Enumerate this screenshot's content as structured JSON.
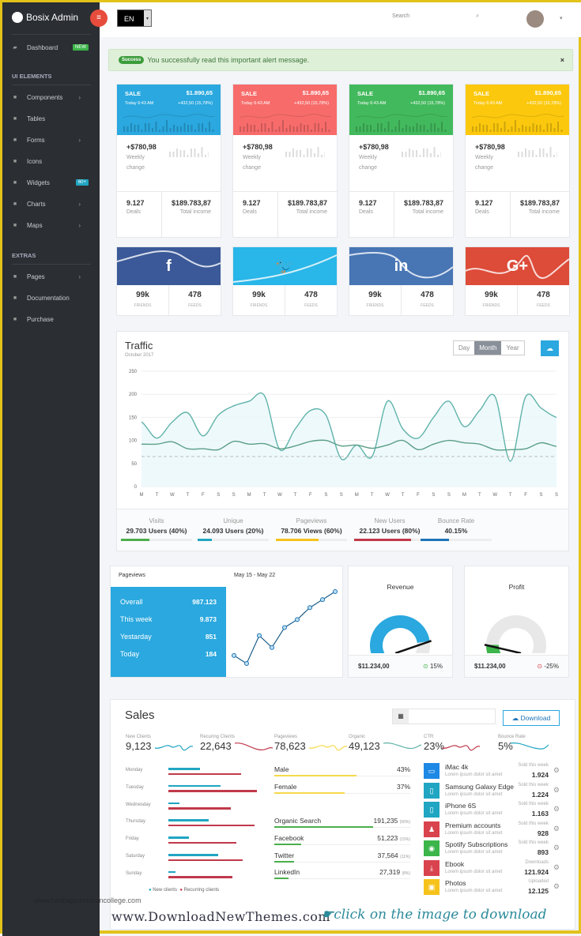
{
  "brand": {
    "name": "Bosix Admin"
  },
  "header": {
    "language": "EN",
    "search_placeholder": "Search"
  },
  "sidebar": {
    "dashboard": {
      "label": "Dashboard",
      "badge": "NEW"
    },
    "section1": "UI ELEMENTS",
    "items": [
      {
        "label": "Components",
        "icon": "puzzle-icon",
        "chevron": true
      },
      {
        "label": "Tables",
        "icon": "table-icon"
      },
      {
        "label": "Forms",
        "icon": "edit-icon",
        "chevron": true
      },
      {
        "label": "Icons",
        "icon": "star-icon"
      },
      {
        "label": "Widgets",
        "icon": "calculator-icon",
        "badge": "60+"
      },
      {
        "label": "Charts",
        "icon": "pie-chart-icon",
        "chevron": true
      },
      {
        "label": "Maps",
        "icon": "map-pin-icon",
        "chevron": true
      }
    ],
    "section2": "EXTRAS",
    "extras": [
      {
        "label": "Pages",
        "icon": "pencil-icon",
        "chevron": true
      },
      {
        "label": "Documentation",
        "icon": "document-icon"
      },
      {
        "label": "Purchase",
        "icon": "cart-icon"
      }
    ]
  },
  "alert": {
    "tag": "Success",
    "message": "You successfully read this important alert message.",
    "close": "×"
  },
  "colors": {
    "blue": "#2aa8df",
    "red": "#f76c6b",
    "green": "#43b95d",
    "yellow": "#fbc80d",
    "facebook": "#3b5998",
    "twitter": "#29b6e8",
    "linkedin": "#4875b4",
    "google": "#dd4b39",
    "sidebar": "#2b2e33"
  },
  "sale_cards": [
    {
      "title": "SALE",
      "amount": "$1.890,65",
      "time": "Today 6:43 AM",
      "delta": "+432,50 (15,78%)",
      "weekly_value": "+$780,98",
      "weekly_label": "Weekly change",
      "deals": "9.127",
      "deals_label": "Deals",
      "income": "$189.783,87",
      "income_label": "Total income",
      "color": "#2aa8df"
    },
    {
      "title": "SALE",
      "amount": "$1.890,65",
      "time": "Today 6:43 AM",
      "delta": "+432,50 (15,78%)",
      "weekly_value": "+$780,98",
      "weekly_label": "Weekly change",
      "deals": "9.127",
      "deals_label": "Deals",
      "income": "$189.783,87",
      "income_label": "Total income",
      "color": "#f76c6b"
    },
    {
      "title": "SALE",
      "amount": "$1.890,65",
      "time": "Today 6:43 AM",
      "delta": "+432,50 (15,78%)",
      "weekly_value": "+$780,98",
      "weekly_label": "Weekly change",
      "deals": "9.127",
      "deals_label": "Deals",
      "income": "$189.783,87",
      "income_label": "Total income",
      "color": "#43b95d"
    },
    {
      "title": "SALE",
      "amount": "$1.890,65",
      "time": "Today 6:43 AM",
      "delta": "+432,50 (15,78%)",
      "weekly_value": "+$780,98",
      "weekly_label": "Weekly change",
      "deals": "9.127",
      "deals_label": "Deals",
      "income": "$189.783,87",
      "income_label": "Total income",
      "color": "#fbc80d"
    }
  ],
  "social_cards": [
    {
      "network": "facebook",
      "glyph": "f",
      "friends": "99k",
      "friends_label": "FRIENDS",
      "feeds": "478",
      "feeds_label": "FEEDS",
      "color": "#3b5998"
    },
    {
      "network": "twitter",
      "glyph": "🐦",
      "friends": "99k",
      "friends_label": "FRIENDS",
      "feeds": "478",
      "feeds_label": "FEEDS",
      "color": "#29b6e8"
    },
    {
      "network": "linkedin",
      "glyph": "in",
      "friends": "99k",
      "friends_label": "FRIENDS",
      "feeds": "478",
      "feeds_label": "FEEDS",
      "color": "#4875b4"
    },
    {
      "network": "google-plus",
      "glyph": "G+",
      "friends": "99k",
      "friends_label": "FRIENDS",
      "feeds": "478",
      "feeds_label": "FEEDS",
      "color": "#dd4b39"
    }
  ],
  "traffic": {
    "title": "Traffic",
    "subtitle": "October 2017",
    "range_options": [
      "Day",
      "Month",
      "Year"
    ],
    "selected": "Month",
    "stats": [
      {
        "label": "Visits",
        "value": "29.703 Users (40%)",
        "percent": 40,
        "color": "#4cae4c"
      },
      {
        "label": "Unique",
        "value": "24.093 Users (20%)",
        "percent": 20,
        "color": "#20a5c2"
      },
      {
        "label": "Pageviews",
        "value": "78.706 Views (60%)",
        "percent": 60,
        "color": "#f6c31c"
      },
      {
        "label": "New Users",
        "value": "22.123 Users (80%)",
        "percent": 80,
        "color": "#c0394b"
      },
      {
        "label": "Bounce Rate",
        "value": "40.15%",
        "percent": 40,
        "color": "#1d74b8"
      }
    ]
  },
  "chart_data": {
    "type": "line",
    "categories": [
      "M",
      "T",
      "W",
      "T",
      "F",
      "S",
      "S",
      "M",
      "T",
      "W",
      "T",
      "F",
      "S",
      "S",
      "M",
      "T",
      "W",
      "T",
      "F",
      "S",
      "S",
      "M",
      "T",
      "W",
      "T",
      "F",
      "S",
      "S"
    ],
    "series": [
      {
        "values": [
          140,
          105,
          140,
          160,
          110,
          155,
          175,
          185,
          197,
          80,
          125,
          165,
          155,
          60,
          90,
          65,
          185,
          125,
          105,
          150,
          185,
          130,
          165,
          195,
          55,
          195,
          170,
          150
        ],
        "color": "#5fb3a9"
      },
      {
        "values": [
          92,
          92,
          97,
          82,
          82,
          80,
          98,
          92,
          93,
          82,
          88,
          98,
          100,
          88,
          90,
          83,
          90,
          100,
          80,
          92,
          100,
          95,
          92,
          80,
          80,
          82,
          95,
          87
        ],
        "color": "#5a9e86"
      }
    ],
    "threshold": 65,
    "ylim": [
      0,
      250
    ],
    "yticks": [
      0,
      50,
      100,
      150,
      200,
      250
    ],
    "grid": true
  },
  "pageviews": {
    "title": "Pageviews",
    "range": "May 15 - May 22",
    "rows": [
      {
        "label": "Overall",
        "value": "987.123"
      },
      {
        "label": "This week",
        "value": "9.873"
      },
      {
        "label": "Yestarday",
        "value": "851"
      },
      {
        "label": "Today",
        "value": "184"
      }
    ],
    "trend": [
      3,
      1,
      8,
      5,
      10,
      12,
      15,
      17,
      19
    ]
  },
  "gauges": [
    {
      "title": "Revenue",
      "value": "$11.234,00",
      "change": "15%",
      "direction": "up",
      "level": 0.85,
      "color": "#2aa8df"
    },
    {
      "title": "Profit",
      "value": "$11.234,00",
      "change": "-25%",
      "direction": "down",
      "level": 0.12,
      "color": "#3cb54a"
    }
  ],
  "sales": {
    "title": "Sales",
    "download": "Download",
    "stats": [
      {
        "label": "New Clients",
        "value": "9,123",
        "color": "#20a5c2"
      },
      {
        "label": "Recuring Clients",
        "value": "22,643",
        "color": "#c0394b"
      },
      {
        "label": "Pageviews",
        "value": "78,623",
        "color": "#f6d94a"
      },
      {
        "label": "Organic",
        "value": "49,123",
        "color": "#5fb3a9"
      },
      {
        "label": "CTR",
        "value": "23%",
        "color": "#c0394b"
      },
      {
        "label": "Bounce Rate",
        "value": "5%",
        "color": "#20a5c2"
      }
    ],
    "days": [
      {
        "day": "Monday",
        "new": 34,
        "recurring": 78
      },
      {
        "day": "Tuesday",
        "new": 56,
        "recurring": 95
      },
      {
        "day": "Wednesday",
        "new": 12,
        "recurring": 67
      },
      {
        "day": "Thursday",
        "new": 43,
        "recurring": 92
      },
      {
        "day": "Friday",
        "new": 22,
        "recurring": 73
      },
      {
        "day": "Saturday",
        "new": 53,
        "recurring": 80
      },
      {
        "day": "Sunday",
        "new": 8,
        "recurring": 69
      }
    ],
    "legend": {
      "new": "New clients",
      "recurring": "Recurring clients"
    },
    "gender": [
      {
        "label": "Male",
        "value": "43%",
        "percent": 43
      },
      {
        "label": "Female",
        "value": "37%",
        "percent": 37
      }
    ],
    "sources": [
      {
        "label": "Organic Search",
        "value": "191,235",
        "pct": "(56%)",
        "percent": 56
      },
      {
        "label": "Facebook",
        "value": "51,223",
        "pct": "(15%)",
        "percent": 15
      },
      {
        "label": "Twitter",
        "value": "37,564",
        "pct": "(11%)",
        "percent": 11
      },
      {
        "label": "LinkedIn",
        "value": "27,319",
        "pct": "(8%)",
        "percent": 8
      }
    ],
    "products": [
      {
        "name": "iMac 4k",
        "desc": "Lorem ipsum dolor sit amet",
        "stat_label": "Sold this week",
        "count": "1.924",
        "icon": "desktop-icon",
        "color": "#1e88e5"
      },
      {
        "name": "Samsung Galaxy Edge",
        "desc": "Lorem ipsum dolor sit amet",
        "stat_label": "Sold this week",
        "count": "1.224",
        "icon": "tablet-icon",
        "color": "#20a5c2"
      },
      {
        "name": "iPhone 6S",
        "desc": "Lorem ipsum dolor sit amet",
        "stat_label": "Sold this week",
        "count": "1.163",
        "icon": "mobile-icon",
        "color": "#20a5c2"
      },
      {
        "name": "Premium accounts",
        "desc": "Lorem ipsum dolor sit amet",
        "stat_label": "Sold this week",
        "count": "928",
        "icon": "user-icon",
        "color": "#d9434e"
      },
      {
        "name": "Spotify Subscriptions",
        "desc": "Lorem ipsum dolor sit amet",
        "stat_label": "Sold this week",
        "count": "893",
        "icon": "spotify-icon",
        "color": "#3cb54a"
      },
      {
        "name": "Ebook",
        "desc": "Lorem ipsum dolor sit amet",
        "stat_label": "Downloads",
        "count": "121.924",
        "icon": "download-icon",
        "color": "#d9434e"
      },
      {
        "name": "Photos",
        "desc": "Lorem ipsum dolor sit amet",
        "stat_label": "Uploaded",
        "count": "12.125",
        "icon": "image-icon",
        "color": "#f6c31c"
      }
    ]
  },
  "watermarks": {
    "left": "www.DownloadNewThemes.com",
    "right": "click on the image to download",
    "corner": "www.heritagechristiancollege.com"
  }
}
